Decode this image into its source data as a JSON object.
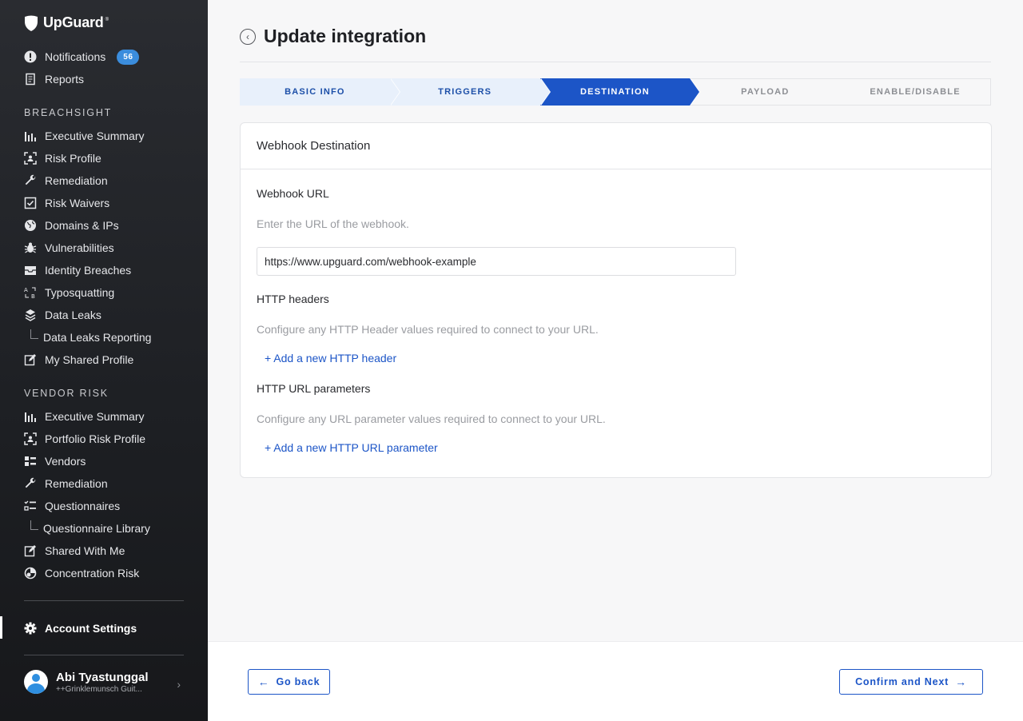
{
  "brand": {
    "name": "UpGuard"
  },
  "sidebar": {
    "notifications": {
      "label": "Notifications",
      "count": "56"
    },
    "reports": {
      "label": "Reports"
    },
    "breachsight": {
      "title": "BREACHSIGHT",
      "items": [
        {
          "label": "Executive Summary",
          "icon": "bar-chart-icon"
        },
        {
          "label": "Risk Profile",
          "icon": "scan-icon"
        },
        {
          "label": "Remediation",
          "icon": "wrench-icon"
        },
        {
          "label": "Risk Waivers",
          "icon": "checkbox-icon"
        },
        {
          "label": "Domains & IPs",
          "icon": "globe-icon"
        },
        {
          "label": "Vulnerabilities",
          "icon": "bug-icon"
        },
        {
          "label": "Identity Breaches",
          "icon": "inbox-icon"
        },
        {
          "label": "Typosquatting",
          "icon": "typo-icon"
        },
        {
          "label": "Data Leaks",
          "icon": "layers-icon"
        },
        {
          "label": "Data Leaks Reporting",
          "icon": ""
        },
        {
          "label": "My Shared Profile",
          "icon": "edit-icon"
        }
      ]
    },
    "vendor_risk": {
      "title": "VENDOR RISK",
      "items": [
        {
          "label": "Executive Summary",
          "icon": "bar-chart-icon"
        },
        {
          "label": "Portfolio Risk Profile",
          "icon": "scan-icon"
        },
        {
          "label": "Vendors",
          "icon": "list-icon"
        },
        {
          "label": "Remediation",
          "icon": "wrench-icon"
        },
        {
          "label": "Questionnaires",
          "icon": "checklist-icon"
        },
        {
          "label": "Questionnaire Library",
          "icon": ""
        },
        {
          "label": "Shared With Me",
          "icon": "edit-icon"
        },
        {
          "label": "Concentration Risk",
          "icon": "pie-icon"
        }
      ]
    },
    "account_settings": {
      "label": "Account Settings"
    },
    "user": {
      "name": "Abi Tyastunggal",
      "org": "++Grinklemunsch Guit..."
    }
  },
  "header": {
    "title": "Update integration"
  },
  "steps": [
    {
      "label": "BASIC INFO",
      "state": "done"
    },
    {
      "label": "TRIGGERS",
      "state": "done"
    },
    {
      "label": "DESTINATION",
      "state": "current"
    },
    {
      "label": "PAYLOAD",
      "state": "todo"
    },
    {
      "label": "ENABLE/DISABLE",
      "state": "todo"
    }
  ],
  "card": {
    "title": "Webhook Destination",
    "webhook_url": {
      "label": "Webhook URL",
      "help": "Enter the URL of the webhook.",
      "value": "https://www.upguard.com/webhook-example"
    },
    "http_headers": {
      "label": "HTTP headers",
      "help": "Configure any HTTP Header values required to connect to your URL.",
      "add_label": "+ Add a new HTTP header"
    },
    "url_params": {
      "label": "HTTP URL parameters",
      "help": "Configure any URL parameter values required to connect to your URL.",
      "add_label": "+ Add a new HTTP URL parameter"
    }
  },
  "footer": {
    "back_label": "Go back",
    "next_label": "Confirm and Next"
  },
  "colors": {
    "accent": "#1c55c7",
    "sidebar_bg": "#1d1f23",
    "badge": "#3b8ddd"
  }
}
